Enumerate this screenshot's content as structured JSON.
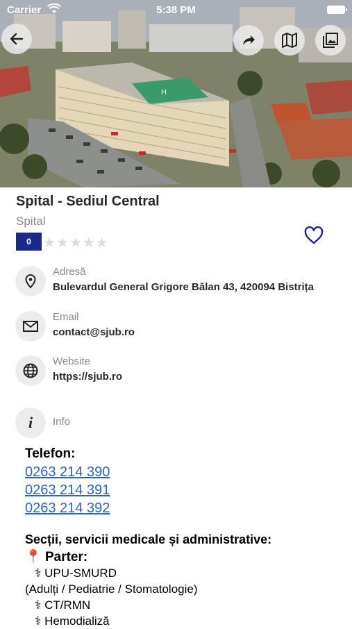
{
  "status_bar": {
    "carrier": "Carrier",
    "time": "5:38 PM"
  },
  "place": {
    "title": "Spital - Sediul Central",
    "category": "Spital",
    "rating_score": "0",
    "rating_stars": 0,
    "rating_max": 5
  },
  "details": {
    "address": {
      "label": "Adresă",
      "value": "Bulevardul General Grigore Bălan 43, 420094 Bistrița"
    },
    "email": {
      "label": "Email",
      "value": "contact@sjub.ro"
    },
    "website": {
      "label": "Website",
      "value": "https://sjub.ro"
    },
    "info": {
      "label": "Info"
    }
  },
  "info_body": {
    "phone_heading": "Telefon:",
    "phones": [
      "0263 214 390",
      "0263 214 391",
      "0263 214 392"
    ],
    "sections_heading": "Secții, servicii medicale și administrative:",
    "floor_heading": "Parter:",
    "floor_pin": "📍",
    "services": [
      "UPU-SMURD",
      "(Adulți / Pediatrie / Stomatologie)",
      "CT/RMN",
      "Hemodializă"
    ]
  },
  "colors": {
    "accent": "#1a2a8c",
    "link": "#2a64c4"
  }
}
